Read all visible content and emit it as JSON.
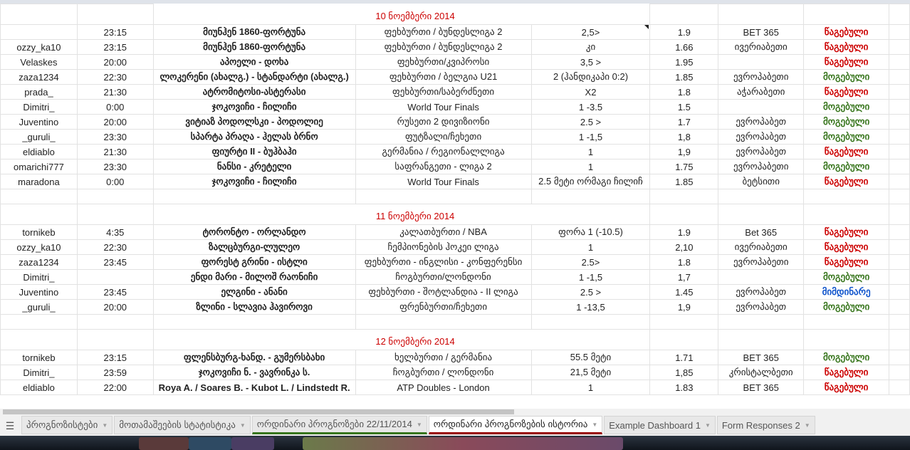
{
  "sections": [
    {
      "date": "10 ნოემბერი 2014",
      "rows": [
        {
          "user": "",
          "time": "23:15",
          "match": "მიუნჰენ 1860-ფორტუნა",
          "category": "ფეხბურთი / ბუნდესლიგა 2",
          "bet": "2,5>",
          "odds": "1.9",
          "bookmaker": "BET 365",
          "result": "წაგებული",
          "status": "lost"
        },
        {
          "user": "ozzy_ka10",
          "time": "23:15",
          "match": "მიუნჰენ 1860-ფორტუნა",
          "category": "ფეხბურთი / ბუნდესლიგა 2",
          "bet": "კი",
          "odds": "1.66",
          "bookmaker": "ივერიაბეთი",
          "result": "წაგებული",
          "status": "lost"
        },
        {
          "user": "Velaskes",
          "time": "20:00",
          "match": "აპოელი - დოხა",
          "category": "ფეხბურთი/კვიპროსი",
          "bet": "3,5 >",
          "odds": "1.95",
          "bookmaker": "",
          "result": "წაგებული",
          "status": "lost"
        },
        {
          "user": "zaza1234",
          "time": "22:30",
          "match": "ლოკერენი (ახალგ.) - სტანდარტი (ახალგ.)",
          "category": "ფეხბურთი / ბელგია U21",
          "bet": "2 (ჰანდიკაპი 0:2)",
          "odds": "1.85",
          "bookmaker": "ევროპაბეთი",
          "result": "მოგებული",
          "status": "won"
        },
        {
          "user": "prada_",
          "time": "21:30",
          "match": "ატრომიტოსი-ასტერასი",
          "category": "ფეხბურთი/საბერძნეთი",
          "bet": "X2",
          "odds": "1.8",
          "bookmaker": "აჭარაბეთი",
          "result": "წაგებული",
          "status": "lost"
        },
        {
          "user": "Dimitri_",
          "time": "0:00",
          "match": "ჯოკოვიჩი - ჩილიჩი",
          "category": "World Tour Finals",
          "bet": "1 -3.5",
          "odds": "1.5",
          "bookmaker": "",
          "result": "მოგებული",
          "status": "won"
        },
        {
          "user": "Juventino",
          "time": "20:00",
          "match": "ვიტიაზ პოდოლსკი - პოდოლიე",
          "category": "რუსეთი 2 დივიზიონი",
          "bet": "2.5 >",
          "odds": "1.7",
          "bookmaker": "ევროპაბეთ",
          "result": "მოგებული",
          "status": "won"
        },
        {
          "user": "_guruli_",
          "time": "23:30",
          "match": "სპარტა პრაღა - ჰელას ბრნო",
          "category": "ფუტზალი/ჩეხეთი",
          "bet": "1 -1,5",
          "odds": "1,8",
          "bookmaker": "ევროპაბეთ",
          "result": "მოგებული",
          "status": "won"
        },
        {
          "user": "eldiablo",
          "time": "21:30",
          "match": "ფიურტი II - ბუჰბაჰი",
          "category": "გერმანია / რეგიონალლიგა",
          "bet": "1",
          "odds": "1,9",
          "bookmaker": "ევროპაბეთ",
          "result": "წაგებული",
          "status": "lost"
        },
        {
          "user": "omarichi777",
          "time": "23:30",
          "match": "ნანსი - კრეტელი",
          "category": "საფრანგეთი - ლიგა 2",
          "bet": "1",
          "odds": "1.75",
          "bookmaker": "ევროპაბეთი",
          "result": "მოგებული",
          "status": "won"
        },
        {
          "user": "maradona",
          "time": "0:00",
          "match": "ჯოკოვიჩი - ჩილიჩი",
          "category": "World Tour Finals",
          "bet": "2.5 მეტი ორმაგი ჩილიჩ",
          "odds": "1.85",
          "bookmaker": "ბეტსითი",
          "result": "წაგებული",
          "status": "lost"
        }
      ]
    },
    {
      "date": "11 ნოემბერი 2014",
      "rows": [
        {
          "user": "tornikeb",
          "time": "4:35",
          "match": "ტორონტო - ორლანდო",
          "category": "კალათბურთი / NBA",
          "bet": "ფორა 1 (-10.5)",
          "odds": "1.9",
          "bookmaker": "Bet 365",
          "result": "წაგებული",
          "status": "lost"
        },
        {
          "user": "ozzy_ka10",
          "time": "22:30",
          "match": "ზალცბურგი-ლულეო",
          "category": "ჩემპიონების ჰოკეი ლიგა",
          "bet": "1",
          "odds": "2,10",
          "bookmaker": "ივერიაბეთი",
          "result": "წაგებული",
          "status": "lost"
        },
        {
          "user": "zaza1234",
          "time": "23:45",
          "match": "ფორესტ გრინი - ისტლი",
          "category": "ფეხბურთი - ინგლისი - კონფერენსი",
          "bet": "2.5>",
          "odds": "1.8",
          "bookmaker": "ევროპაბეთი",
          "result": "წაგებული",
          "status": "lost"
        },
        {
          "user": "Dimitri_",
          "time": "",
          "match": "ენდი მარი - მილოშ რაონიჩი",
          "category": "ჩოგბურთი/ლონდონი",
          "bet": "1 -1,5",
          "odds": "1,7",
          "bookmaker": "",
          "result": "მოგებული",
          "status": "won"
        },
        {
          "user": "Juventino",
          "time": "23:45",
          "match": "ელგინი - ანანი",
          "category": "ფეხბურთი - შოტლანდია - II ლიგა",
          "bet": "2.5 >",
          "odds": "1.45",
          "bookmaker": "ევროპაბეთ",
          "result": "მიმდინარე",
          "status": "pending"
        },
        {
          "user": "_guruli_",
          "time": "20:00",
          "match": "ზლინი - სლავია ჰავიროვი",
          "category": "ფრენბურთი/ჩეხეთი",
          "bet": "1 -13,5",
          "odds": "1,9",
          "bookmaker": "ევროპაბეთ",
          "result": "მოგებული",
          "status": "won"
        }
      ]
    },
    {
      "date": "12 ნოემბერი 2014",
      "rows": [
        {
          "user": "tornikeb",
          "time": "23:15",
          "match": "ფლენსბურგ-ხანდ. - გუმერსბახი",
          "category": "ხელბურთი / გერმანია",
          "bet": "55.5 მეტი",
          "odds": "1.71",
          "bookmaker": "BET 365",
          "result": "მოგებული",
          "status": "won"
        },
        {
          "user": "Dimitri_",
          "time": "23:59",
          "match": "ჯოკოვიჩი ნ. - ვავრინკა ს.",
          "category": "ჩოგბურთი / ლონდონი",
          "bet": "21,5 მეტი",
          "odds": "1,85",
          "bookmaker": "კრისტალბეთი",
          "result": "წაგებული",
          "status": "lost"
        },
        {
          "user": "eldiablo",
          "time": "22:00",
          "match": "Roya A. / Soares B. - Kubot L. / Lindstedt R.",
          "category": "ATP Doubles - London",
          "bet": "1",
          "odds": "1.83",
          "bookmaker": "BET 365",
          "result": "წაგებული",
          "status": "lost"
        }
      ]
    }
  ],
  "tabs": [
    {
      "label": "პროგნოზისტები",
      "state": "normal"
    },
    {
      "label": "მოთამაშეების სტატისტიკა",
      "state": "normal"
    },
    {
      "label": "ორდინარი პროგნოზები 22/11/2014",
      "state": "green"
    },
    {
      "label": "ორდინარი პროგნოზების ისტორია",
      "state": "active"
    },
    {
      "label": "Example Dashboard 1",
      "state": "normal"
    },
    {
      "label": "Form Responses 2",
      "state": "normal"
    }
  ],
  "colors": {
    "lost": "#cc0000",
    "won": "#38761d",
    "pending": "#1155cc",
    "date": "#cc0000"
  }
}
